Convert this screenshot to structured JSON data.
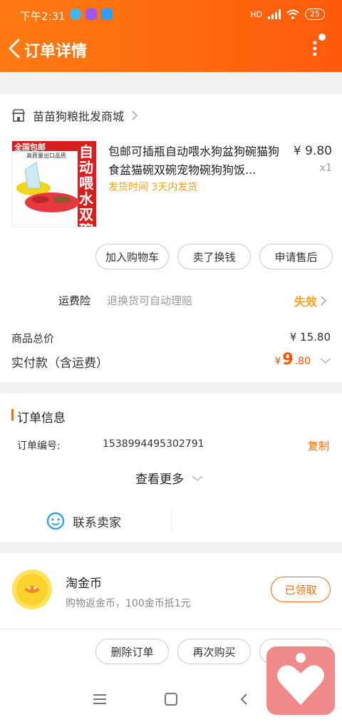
{
  "status_bar": {
    "time": "下午2:31",
    "network": "HD",
    "battery": "25"
  },
  "header": {
    "title": "订单详情"
  },
  "shop": {
    "name": "苗苗狗粮批发商城"
  },
  "product": {
    "name": "包邮可插瓶自动喂水狗盆狗碗猫狗食盆猫碗双碗宠物碗狗狗饭...",
    "ship_time": "发货时间  3天内发货",
    "price": "¥ 9.80",
    "qty": "x1",
    "image_text": {
      "banner": "全国包邮",
      "sub": "高质量出口品质",
      "side": "自动喂水双碗"
    }
  },
  "actions": {
    "add_cart": "加入购物车",
    "sell": "卖了换钱",
    "after_sale": "申请售后"
  },
  "freight_insurance": {
    "label": "运费险",
    "desc": "退换货可自动理赔",
    "status": "失效"
  },
  "totals": {
    "goods_total_label": "商品总价",
    "goods_total_value": "¥ 15.80",
    "paid_label": "实付款（含运费）",
    "paid_currency": "¥",
    "paid_int": "9",
    "paid_dec": ".80"
  },
  "order_info": {
    "section_title": "订单信息",
    "order_no_label": "订单编号:",
    "order_no_value": "1538994495302791",
    "copy_label": "复制",
    "see_more": "查看更多",
    "contact_seller": "联系卖家"
  },
  "coins": {
    "title": "淘金币",
    "desc": "购物返金币，100金币抵1元",
    "button": "已领取"
  },
  "bottom_actions": {
    "delete": "删除订单",
    "rebuy": "再次购买"
  },
  "colors": {
    "accent": "#ff6a0e",
    "price_red": "#ff5000",
    "yellow": "#f7a21c",
    "float_pink": "#f08a8a"
  }
}
